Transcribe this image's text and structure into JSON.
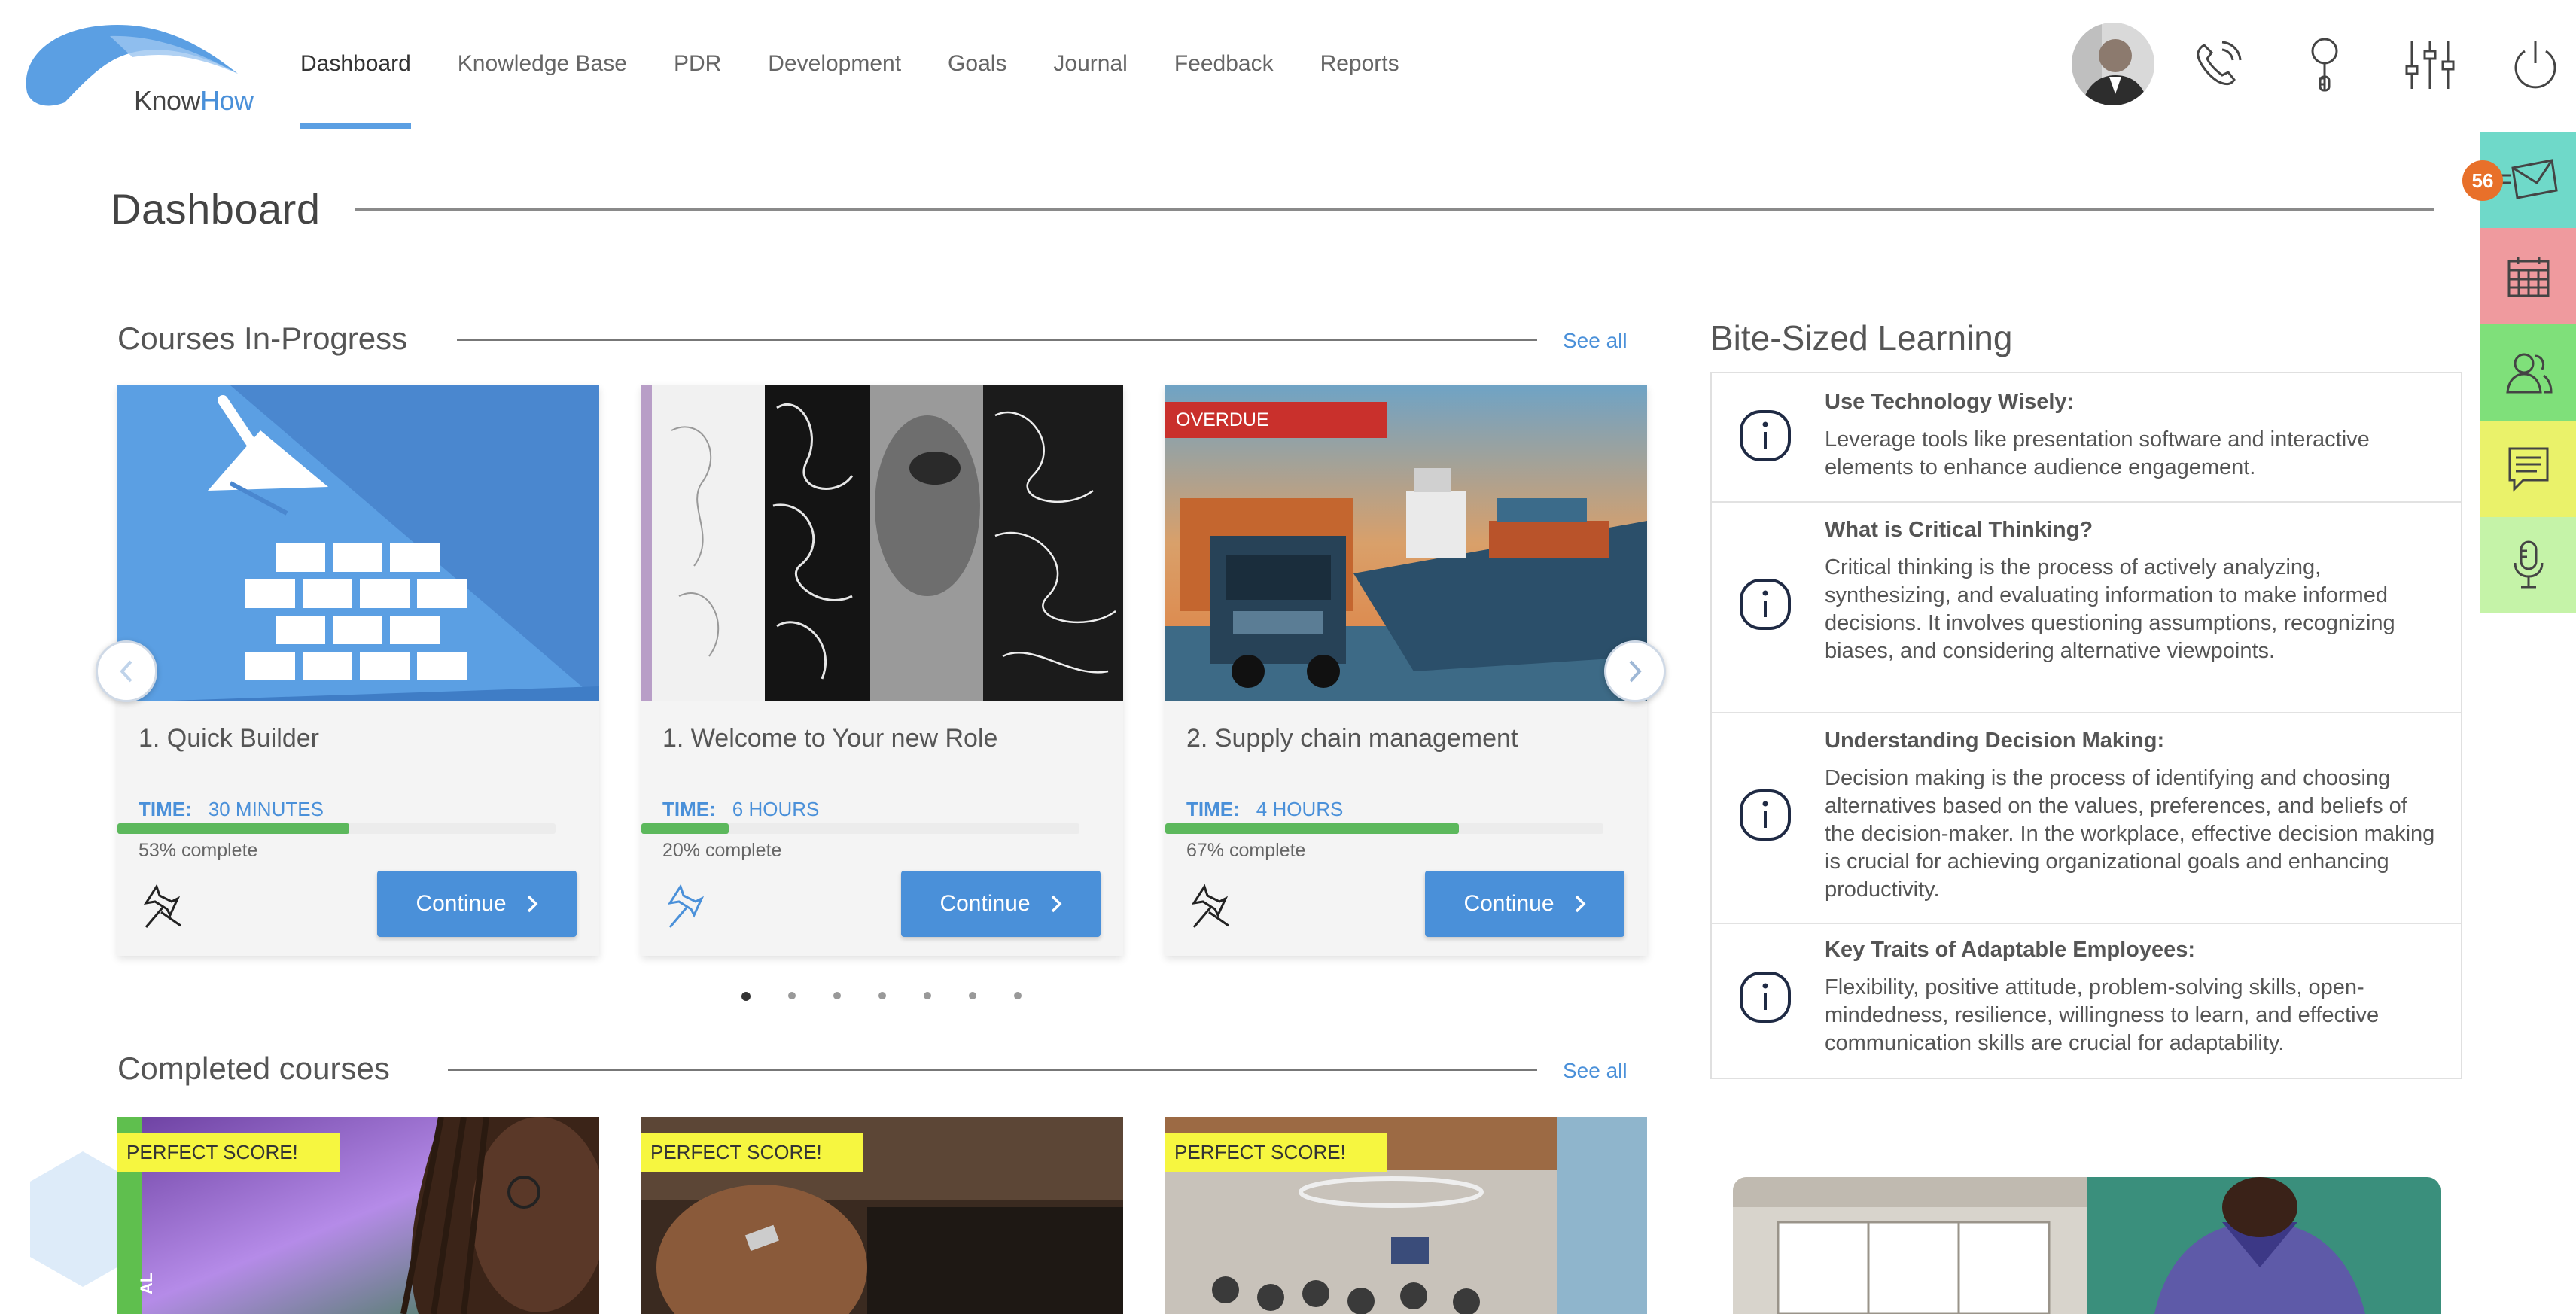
{
  "app": {
    "logo_know": "Know",
    "logo_how": "How"
  },
  "nav": {
    "items": [
      {
        "label": "Dashboard",
        "active": true
      },
      {
        "label": "Knowledge Base"
      },
      {
        "label": "PDR"
      },
      {
        "label": "Development"
      },
      {
        "label": "Goals"
      },
      {
        "label": "Journal"
      },
      {
        "label": "Feedback"
      },
      {
        "label": "Reports"
      }
    ]
  },
  "header_icons": [
    "avatar",
    "phone-icon",
    "key-icon",
    "sliders-icon",
    "power-icon"
  ],
  "rail": {
    "items": [
      {
        "name": "mail",
        "color": "#6fd9c9",
        "badge": "56"
      },
      {
        "name": "calendar",
        "color": "#ef9a9e"
      },
      {
        "name": "contacts",
        "color": "#7fe07a"
      },
      {
        "name": "notes",
        "color": "#eaf26a"
      },
      {
        "name": "microphone",
        "color": "#c5f3a8"
      }
    ]
  },
  "page": {
    "title": "Dashboard"
  },
  "in_progress": {
    "title": "Courses In-Progress",
    "see_all": "See all",
    "time_label": "TIME:",
    "continue_label": "Continue",
    "courses": [
      {
        "title": "1. Quick Builder",
        "time": "30 MINUTES",
        "percent_text": "53% complete",
        "progress": 0.53,
        "pinned": false
      },
      {
        "title": "1. Welcome to Your new Role",
        "time": "6 HOURS",
        "percent_text": "20% complete",
        "progress": 0.2,
        "pinned": true
      },
      {
        "title": "2. Supply chain management",
        "time": "4 HOURS",
        "percent_text": "67% complete",
        "progress": 0.67,
        "pinned": false,
        "badge": "OVERDUE"
      }
    ],
    "dots_count": 7,
    "active_dot": 0
  },
  "completed": {
    "title": "Completed courses",
    "see_all": "See all",
    "badge": "PERFECT SCORE!",
    "side_text": "AL"
  },
  "bite": {
    "title": "Bite-Sized Learning",
    "items": [
      {
        "heading": "Use Technology Wisely:",
        "body": "Leverage tools like presentation software and interactive elements to enhance audience engagement."
      },
      {
        "heading": "What is Critical Thinking?",
        "body": "Critical thinking is the process of actively analyzing, synthesizing, and evaluating information to make informed decisions. It involves questioning assumptions, recognizing biases, and considering alternative viewpoints."
      },
      {
        "heading": "Understanding Decision Making:",
        "body": "Decision making is the process of identifying and choosing alternatives based on the values, preferences, and beliefs of the decision-maker. In the workplace, effective decision making is crucial for achieving organizational goals and enhancing productivity."
      },
      {
        "heading": "Key Traits of Adaptable Employees:",
        "body": "Flexibility, positive attitude, problem-solving skills, open-mindedness, resilience, willingness to learn, and effective communication skills are crucial for adaptability."
      }
    ]
  },
  "colors": {
    "accent": "#4a90d9",
    "progress": "#5cb85c",
    "overdue": "#c9302c",
    "perfect": "#f6f640"
  }
}
